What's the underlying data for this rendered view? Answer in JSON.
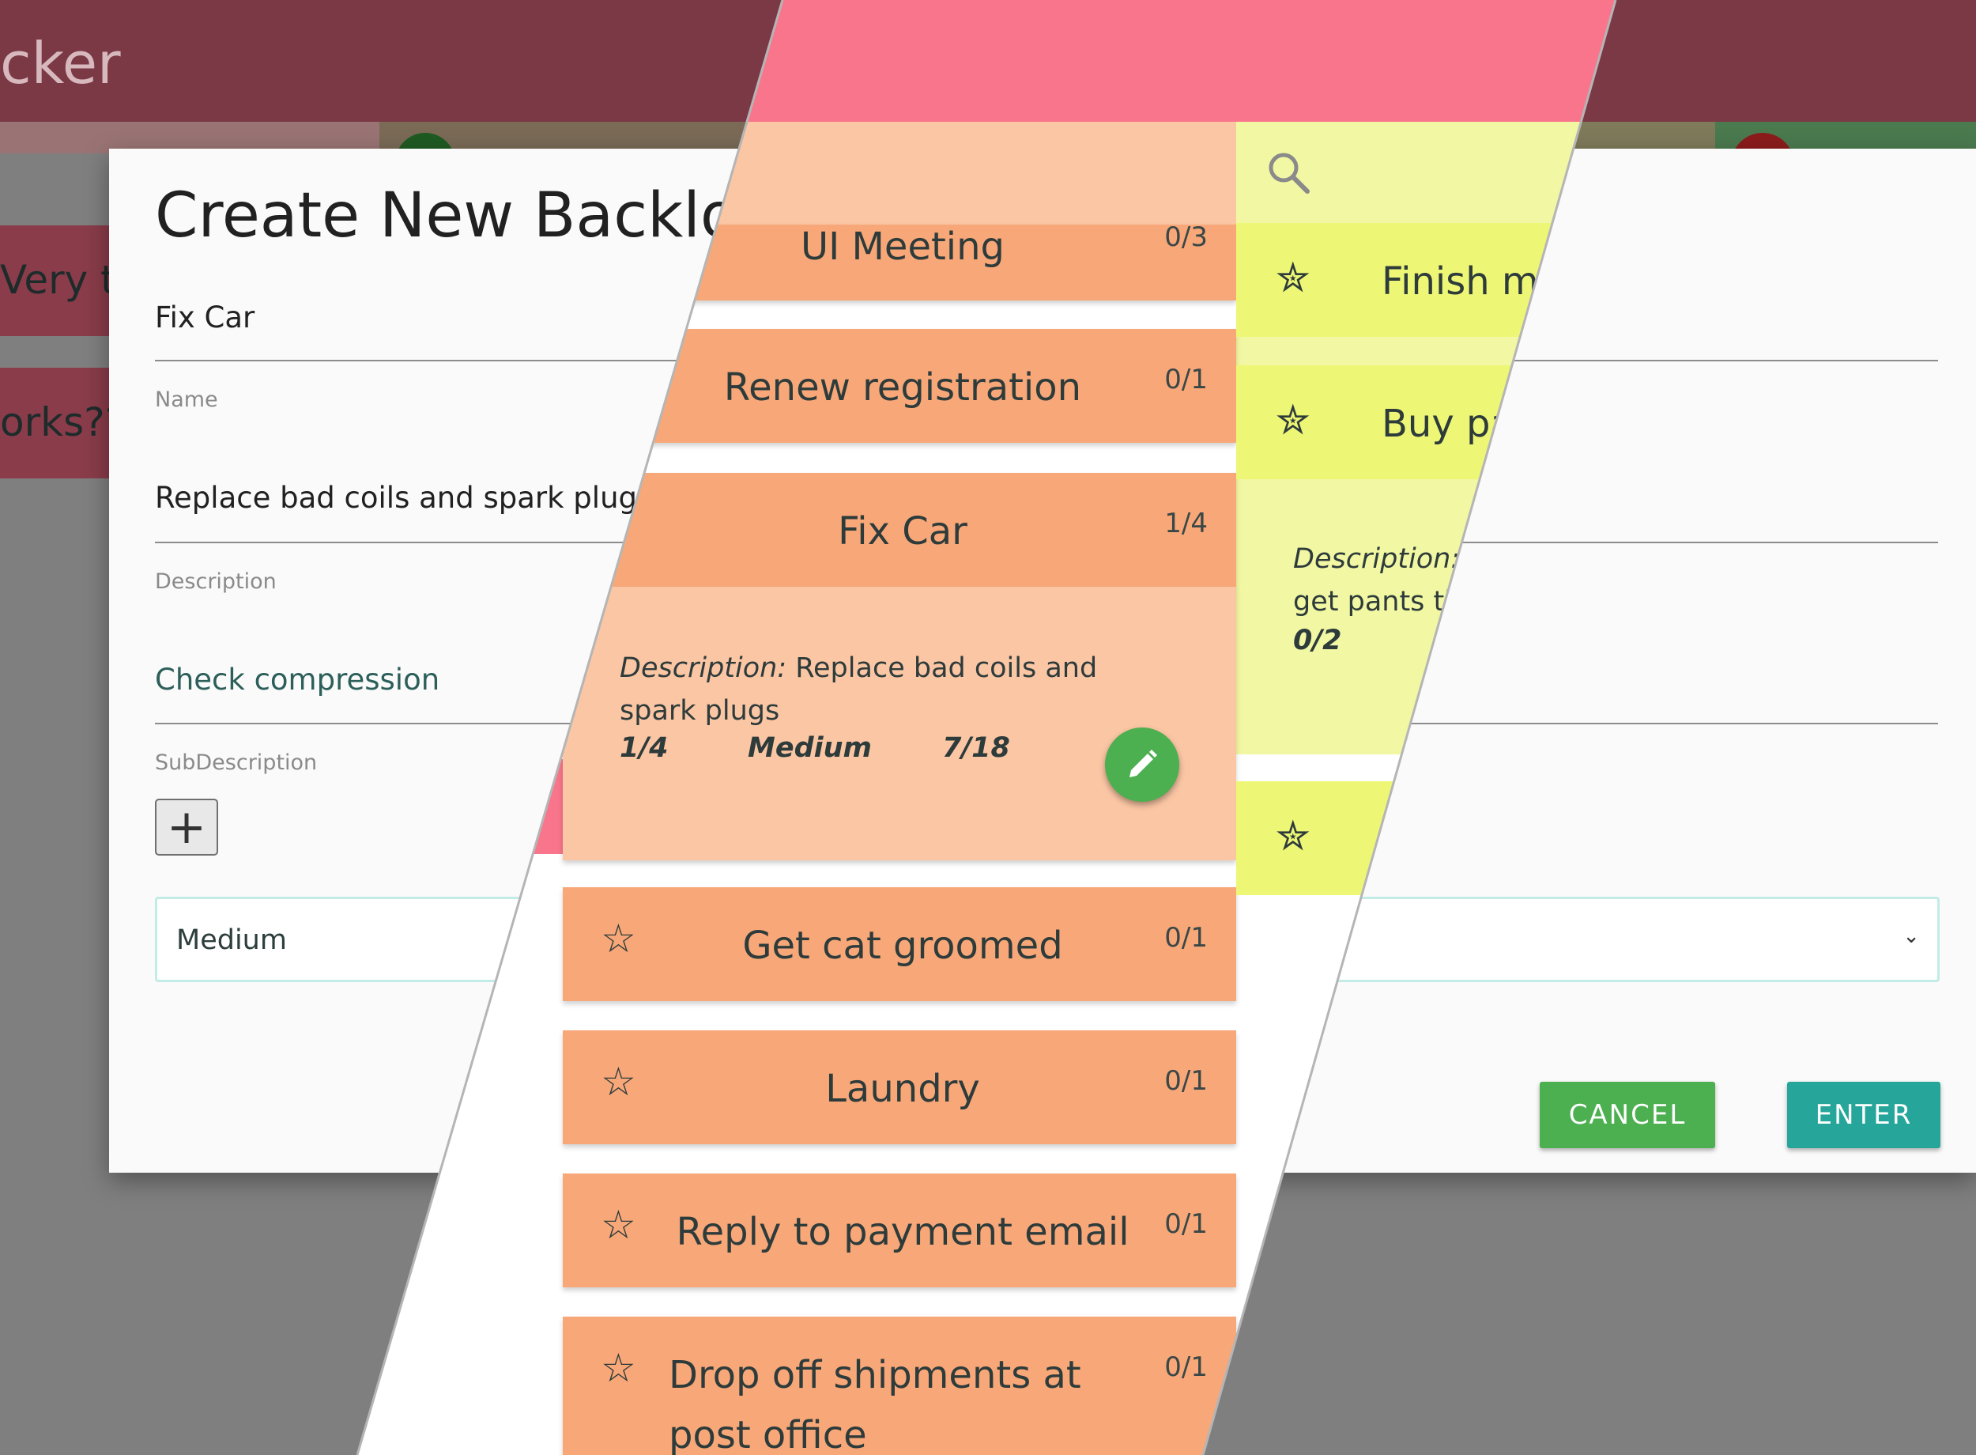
{
  "background_app": {
    "title": "cker",
    "cards": [
      "Very ta",
      "orks??"
    ]
  },
  "modal": {
    "title": "Create New Backlog",
    "name_value": "Fix Car",
    "name_label": "Name",
    "description_value": "Replace bad coils and spark plugs",
    "description_label": "Description",
    "subdescription_value": "Check compression",
    "subdescription_label": "SubDescription",
    "add_subdescription_label": "+",
    "priority_selected": "Medium",
    "priority_caret": "⌄",
    "cancel_label": "CANCEL",
    "enter_label": "ENTER"
  },
  "zoom_panel": {
    "search_icon": "search-icon",
    "tasks": [
      {
        "name": "UI Meeting",
        "count": "0/3"
      },
      {
        "name": "Renew registration",
        "count": "0/1"
      },
      {
        "name": "Fix Car",
        "count": "1/4"
      },
      {
        "name": "Get cat groomed",
        "count": "0/1"
      },
      {
        "name": "Laundry",
        "count": "0/1"
      },
      {
        "name": "Reply to payment email",
        "count": "0/1"
      },
      {
        "name": "Drop off shipments at post office",
        "count": "0/1"
      }
    ],
    "expanded_task": {
      "description_label": "Description:",
      "description_text": "Replace bad coils and spark plugs",
      "progress": "1/4",
      "priority": "Medium",
      "date": "7/18"
    },
    "star_glyph": "☆",
    "filled_star_glyph": "✮",
    "right_tasks": [
      {
        "name": "Finish mo"
      },
      {
        "name": "Buy pa"
      },
      {
        "name": ""
      }
    ],
    "right_expanded": {
      "description_label": "Description:",
      "description_text": "get pants th",
      "progress": "0/2"
    }
  },
  "colors": {
    "header_pink": "#f8758b",
    "task_orange": "#f8a878",
    "task_light": "#fbc6a4",
    "highlight_yellow": "#eef775",
    "cancel_green": "#4caf50",
    "enter_teal": "#26a69a"
  }
}
